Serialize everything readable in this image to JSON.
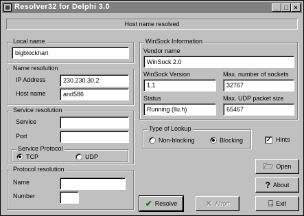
{
  "window": {
    "title": "Resolver32 for Delphi 3.0",
    "controls": {
      "minimize": "_",
      "maximize": "□",
      "close": "×"
    }
  },
  "status": "Host name resolved",
  "local_name": {
    "group": "Local name",
    "value": "bigblockhart"
  },
  "name_resolution": {
    "group": "Name resolution",
    "ip_label": "IP Address",
    "ip_value": "230.230.30.2",
    "host_label": "Host name",
    "host_value": "and586"
  },
  "service_resolution": {
    "group": "Service resolution",
    "service_label": "Service",
    "service_value": "",
    "port_label": "Port",
    "port_value": "",
    "protocol_group": "Service Protocol",
    "tcp_label": "TCP",
    "udp_label": "UDP",
    "selected": "TCP"
  },
  "protocol_resolution": {
    "group": "Protocol resolution",
    "name_label": "Name",
    "name_value": "",
    "number_label": "Number",
    "number_value": ""
  },
  "winsock": {
    "group": "WinSock Information",
    "vendor_label": "Vendor name",
    "vendor_value": "WinSock 2.0",
    "version_label": "WinSock Version",
    "version_value": "1.1",
    "max_sockets_label": "Max. number of sockets",
    "max_sockets_value": "32767",
    "status_label": "Status",
    "status_value": "Running (llu.h)",
    "max_udp_label": "Max. UDP packet size",
    "max_udp_value": "65467"
  },
  "lookup": {
    "group": "Type of Lookup",
    "nonblocking_label": "Non-blocking",
    "blocking_label": "Blocking",
    "selected": "Blocking"
  },
  "hints": {
    "label": "Hints",
    "checked": true
  },
  "buttons": {
    "open": "Open",
    "about": "About",
    "resolve": "Resolve",
    "abort": "Abort",
    "exit": "Exit"
  }
}
